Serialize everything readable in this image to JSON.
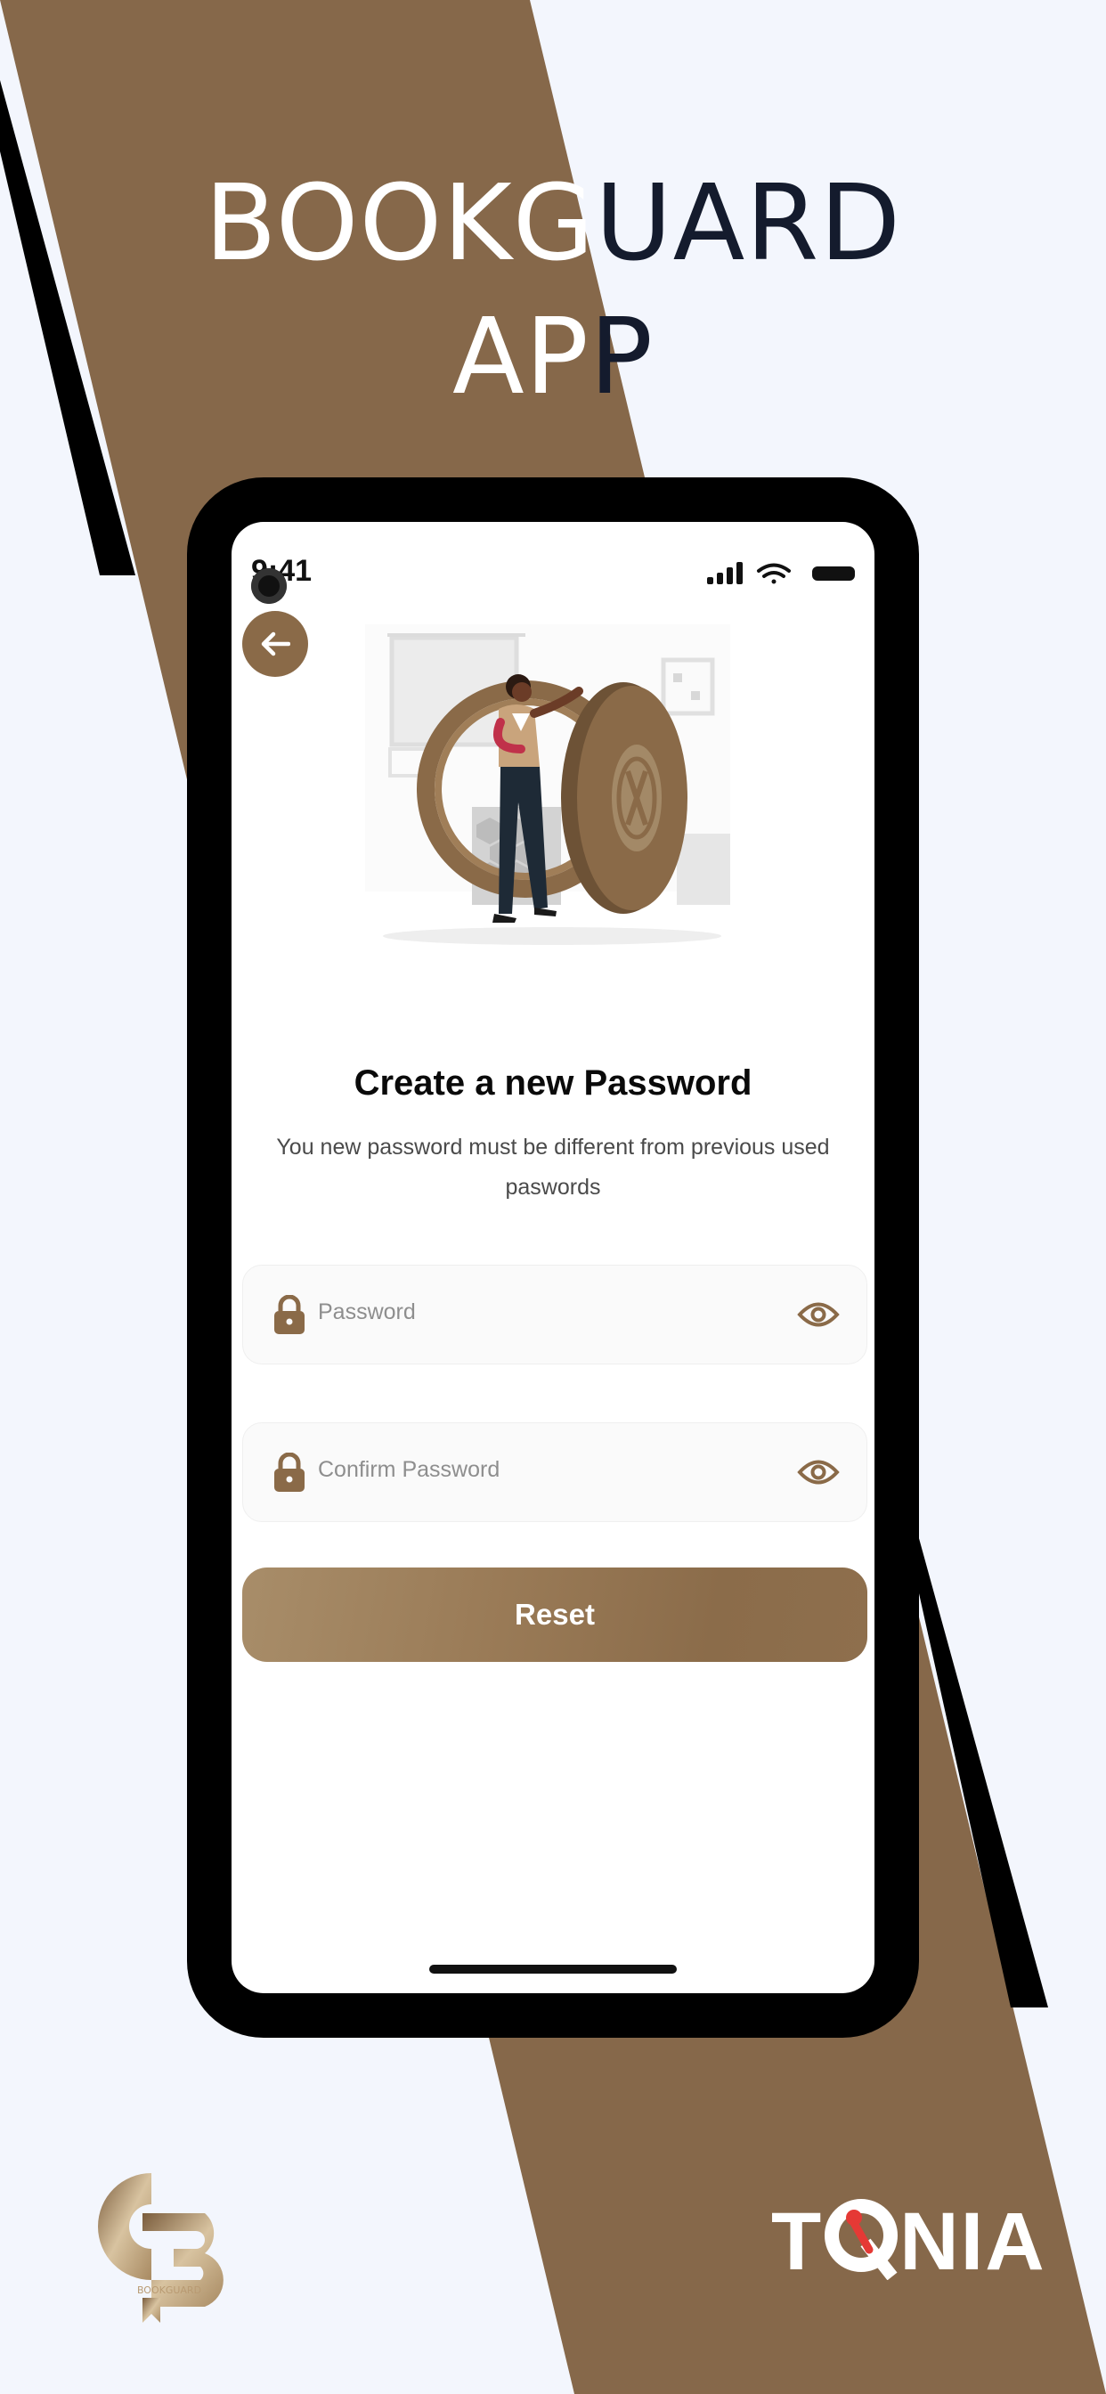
{
  "promo": {
    "headline_line1_left": "BOOKG",
    "headline_line1_right": "UARD",
    "headline_line2_left": "AP",
    "headline_line2_right": "P",
    "brand_logo_text": "BOOKGUARD",
    "agency_logo_text_left": "T",
    "agency_logo_text_right": "NIA",
    "colors": {
      "brown": "#8a6a48",
      "dark": "#141b2d",
      "light_bg": "#f3f6fd"
    }
  },
  "status_bar": {
    "time": "9:41"
  },
  "back_button": {
    "icon": "arrow-left-icon"
  },
  "illustration": {
    "icon": "person-with-vault-door-illustration"
  },
  "screen": {
    "title": "Create a new Password",
    "subtitle": "You new password must be different from previous used paswords"
  },
  "form": {
    "password": {
      "placeholder": "Password",
      "icon": "lock-icon",
      "toggle_icon": "eye-icon"
    },
    "confirm_password": {
      "placeholder": "Confirm Password",
      "icon": "lock-icon",
      "toggle_icon": "eye-icon"
    },
    "reset_label": "Reset"
  }
}
